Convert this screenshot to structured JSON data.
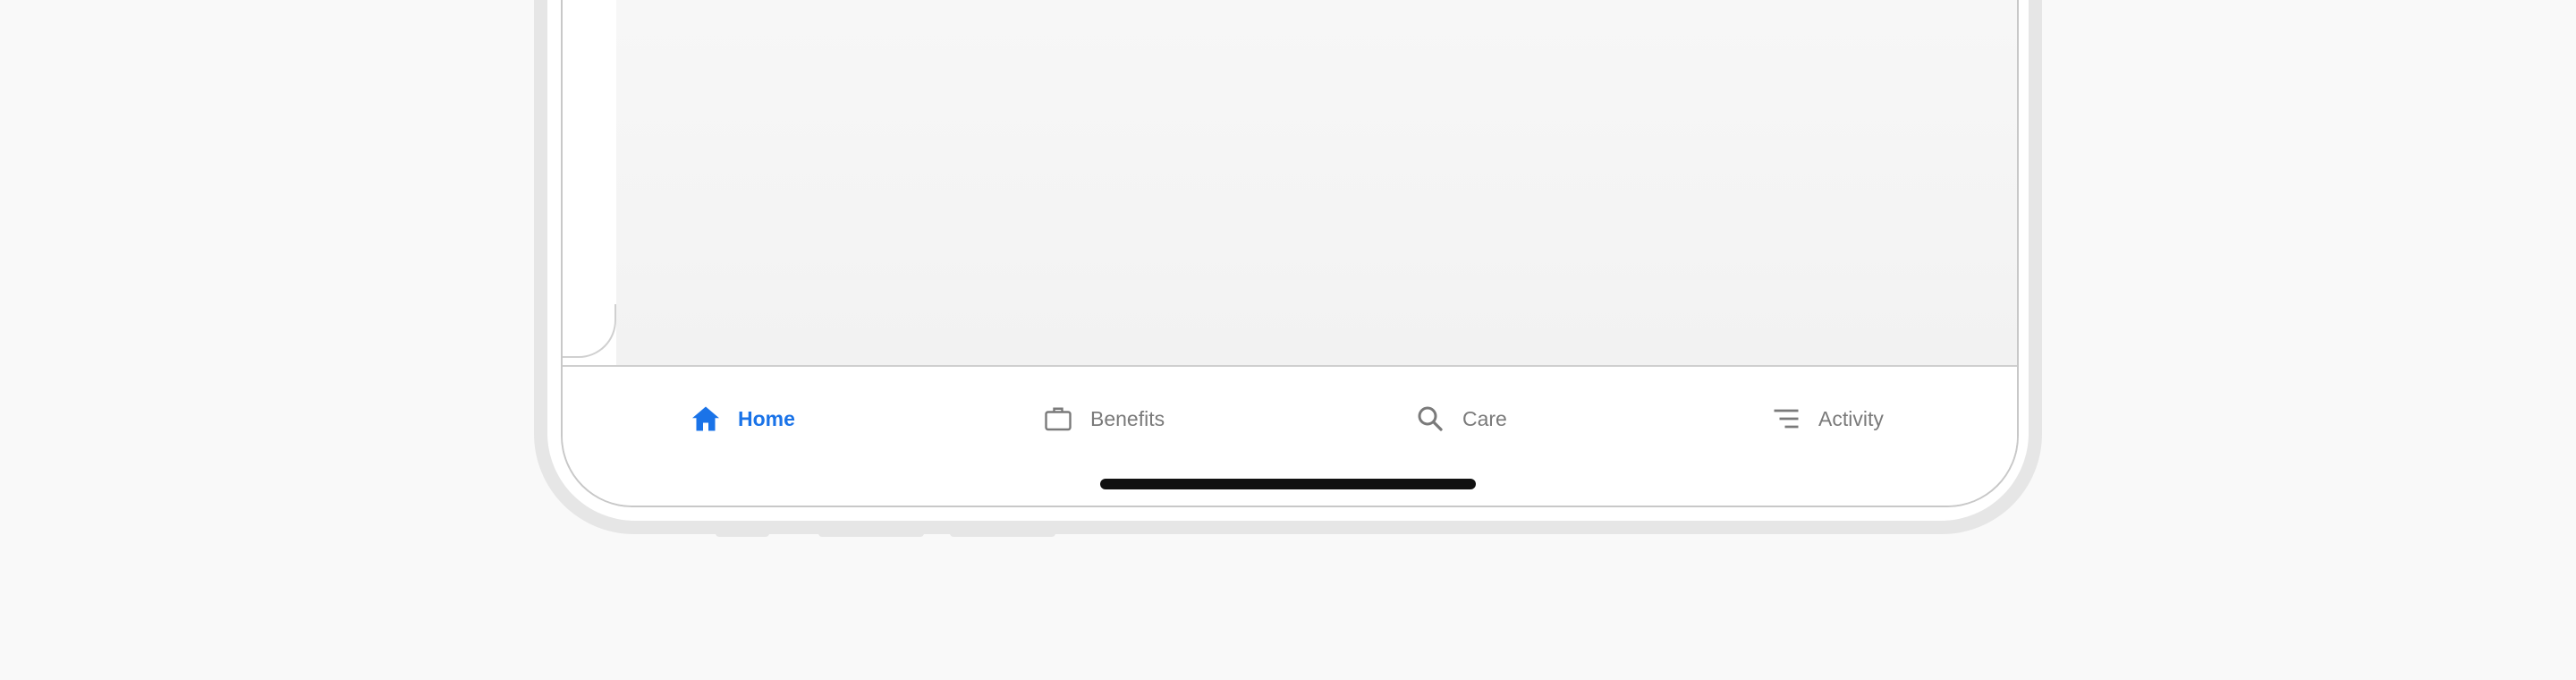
{
  "tabs": [
    {
      "label": "Home",
      "icon": "home-icon",
      "active": true
    },
    {
      "label": "Benefits",
      "icon": "briefcase-icon",
      "active": false
    },
    {
      "label": "Care",
      "icon": "search-icon",
      "active": false
    },
    {
      "label": "Activity",
      "icon": "list-icon",
      "active": false
    }
  ],
  "colors": {
    "active": "#1a73e8",
    "inactive": "#7a7a7a",
    "background": "#f9f9f9"
  }
}
